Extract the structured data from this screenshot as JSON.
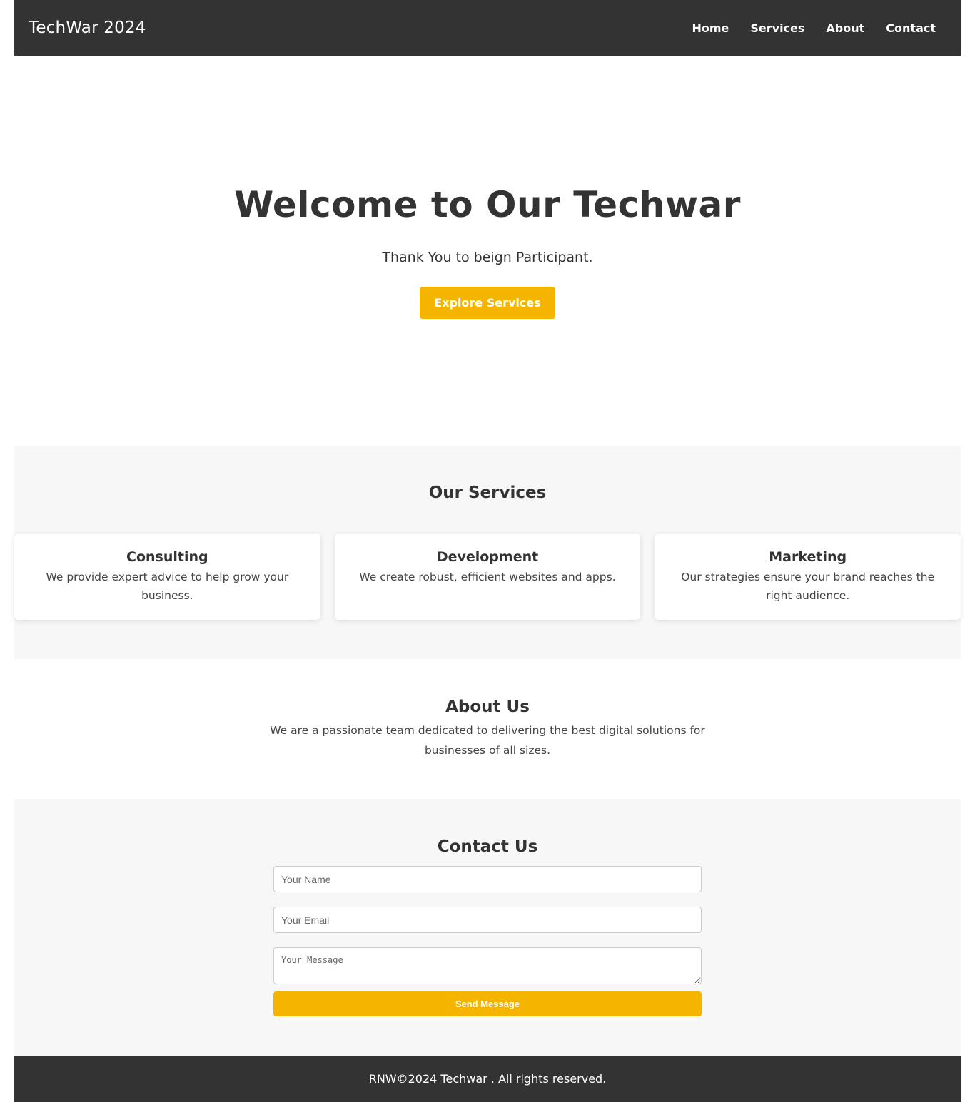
{
  "header": {
    "brand": "TechWar 2024",
    "nav": [
      "Home",
      "Services",
      "About",
      "Contact"
    ]
  },
  "hero": {
    "title": "Welcome to Our Techwar",
    "subtitle": "Thank You to beign Participant.",
    "cta_label": "Explore Services"
  },
  "services": {
    "title": "Our Services",
    "cards": [
      {
        "title": "Consulting",
        "text": "We provide expert advice to help grow your business."
      },
      {
        "title": "Development",
        "text": "We create robust, efficient websites and apps."
      },
      {
        "title": "Marketing",
        "text": "Our strategies ensure your brand reaches the right audience."
      }
    ]
  },
  "about": {
    "title": "About Us",
    "text": "We are a passionate team dedicated to delivering the best digital solutions for businesses of all sizes."
  },
  "contact": {
    "title": "Contact Us",
    "name_placeholder": "Your Name",
    "email_placeholder": "Your Email",
    "message_placeholder": "Your Message",
    "send_label": "Send Message"
  },
  "footer": {
    "text": "RNW©2024 Techwar . All rights reserved."
  },
  "colors": {
    "header_bg": "#333333",
    "accent": "#f4b400",
    "section_bg": "#f7f7f7"
  }
}
